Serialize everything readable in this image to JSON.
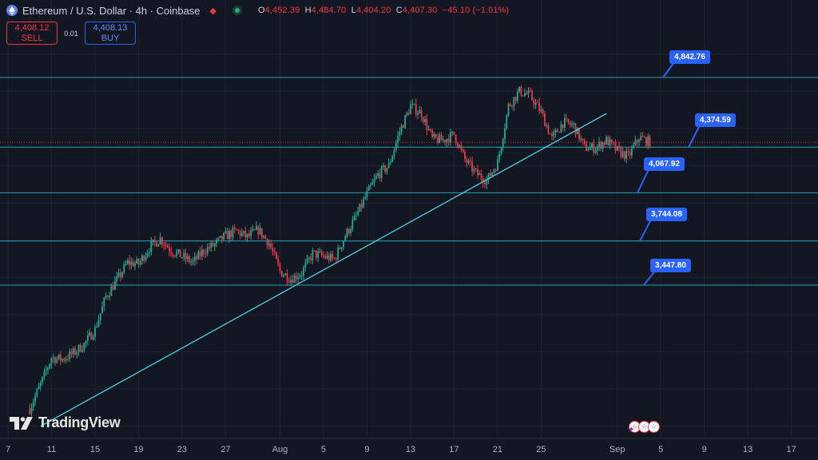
{
  "header": {
    "symbol_title": "Ethereum / U.S. Dollar · 4h · Coinbase",
    "ohlc": {
      "o_label": "O",
      "o": "4,452.39",
      "h_label": "H",
      "h": "4,484.70",
      "l_label": "L",
      "l": "4,404.20",
      "c_label": "C",
      "c": "4,407.30",
      "change": "−45.10 (−1.01%)"
    }
  },
  "trade": {
    "sell_price": "4,408.12",
    "sell_label": "SELL",
    "spread": "0.01",
    "buy_price": "4,408.13",
    "buy_label": "BUY"
  },
  "brand": {
    "name": "TradingView"
  },
  "icons": [
    "ethereum-icon",
    "flag-icon",
    "market-status-icon",
    "tradingview-logo-icon",
    "us-flag-icon"
  ],
  "colors": {
    "background": "#131722",
    "up": "#22ab94",
    "down": "#f23645",
    "level_line": "#27a2b8",
    "trendline": "#4dd0e1",
    "callout": "#2962ff"
  },
  "chart_data": {
    "type": "candlestick",
    "title": "Ethereum / U.S. Dollar · 4h · Coinbase",
    "timeframe": "4h",
    "grid": true,
    "x_ticks": [
      "7",
      "11",
      "15",
      "19",
      "23",
      "27",
      "Aug",
      "5",
      "9",
      "13",
      "17",
      "21",
      "25",
      "Sep",
      "5",
      "9",
      "13",
      "17"
    ],
    "horizontal_levels": [
      {
        "value": 4842.76,
        "label": "4,842.76"
      },
      {
        "value": 4374.59,
        "label": "4,374.59"
      },
      {
        "value": 4067.92,
        "label": "4,067.92"
      },
      {
        "value": 3744.08,
        "label": "3,744.08"
      },
      {
        "value": 3447.8,
        "label": "3,447.80"
      }
    ],
    "trendline": {
      "from": {
        "date": "2025-07-10",
        "price": 2500
      },
      "to": {
        "date": "2025-08-31",
        "price": 4600
      }
    },
    "last_price": 4407.3,
    "close_path": [
      [
        "2025-07-09",
        2620
      ],
      [
        "2025-07-10",
        2780
      ],
      [
        "2025-07-11",
        2960
      ],
      [
        "2025-07-12",
        2950
      ],
      [
        "2025-07-13",
        2990
      ],
      [
        "2025-07-14",
        3050
      ],
      [
        "2025-07-15",
        3150
      ],
      [
        "2025-07-16",
        3370
      ],
      [
        "2025-07-17",
        3480
      ],
      [
        "2025-07-18",
        3600
      ],
      [
        "2025-07-19",
        3590
      ],
      [
        "2025-07-20",
        3700
      ],
      [
        "2025-07-21",
        3760
      ],
      [
        "2025-07-22",
        3680
      ],
      [
        "2025-07-23",
        3640
      ],
      [
        "2025-07-24",
        3600
      ],
      [
        "2025-07-25",
        3680
      ],
      [
        "2025-07-26",
        3720
      ],
      [
        "2025-07-27",
        3780
      ],
      [
        "2025-07-28",
        3810
      ],
      [
        "2025-07-29",
        3770
      ],
      [
        "2025-07-30",
        3820
      ],
      [
        "2025-07-31",
        3730
      ],
      [
        "2025-08-01",
        3540
      ],
      [
        "2025-08-02",
        3490
      ],
      [
        "2025-08-03",
        3530
      ],
      [
        "2025-08-04",
        3660
      ],
      [
        "2025-08-05",
        3640
      ],
      [
        "2025-08-06",
        3620
      ],
      [
        "2025-08-07",
        3780
      ],
      [
        "2025-08-08",
        3910
      ],
      [
        "2025-08-09",
        4060
      ],
      [
        "2025-08-10",
        4190
      ],
      [
        "2025-08-11",
        4250
      ],
      [
        "2025-08-12",
        4480
      ],
      [
        "2025-08-13",
        4650
      ],
      [
        "2025-08-14",
        4600
      ],
      [
        "2025-08-15",
        4430
      ],
      [
        "2025-08-16",
        4420
      ],
      [
        "2025-08-17",
        4460
      ],
      [
        "2025-08-18",
        4290
      ],
      [
        "2025-08-19",
        4200
      ],
      [
        "2025-08-20",
        4150
      ],
      [
        "2025-08-21",
        4270
      ],
      [
        "2025-08-22",
        4650
      ],
      [
        "2025-08-23",
        4750
      ],
      [
        "2025-08-24",
        4720
      ],
      [
        "2025-08-25",
        4610
      ],
      [
        "2025-08-26",
        4430
      ],
      [
        "2025-08-27",
        4540
      ],
      [
        "2025-08-28",
        4520
      ],
      [
        "2025-08-29",
        4370
      ],
      [
        "2025-08-30",
        4370
      ],
      [
        "2025-08-31",
        4420
      ],
      [
        "2025-09-01",
        4350
      ],
      [
        "2025-09-02",
        4310
      ],
      [
        "2025-09-03",
        4440
      ],
      [
        "2025-09-04",
        4407
      ]
    ]
  }
}
